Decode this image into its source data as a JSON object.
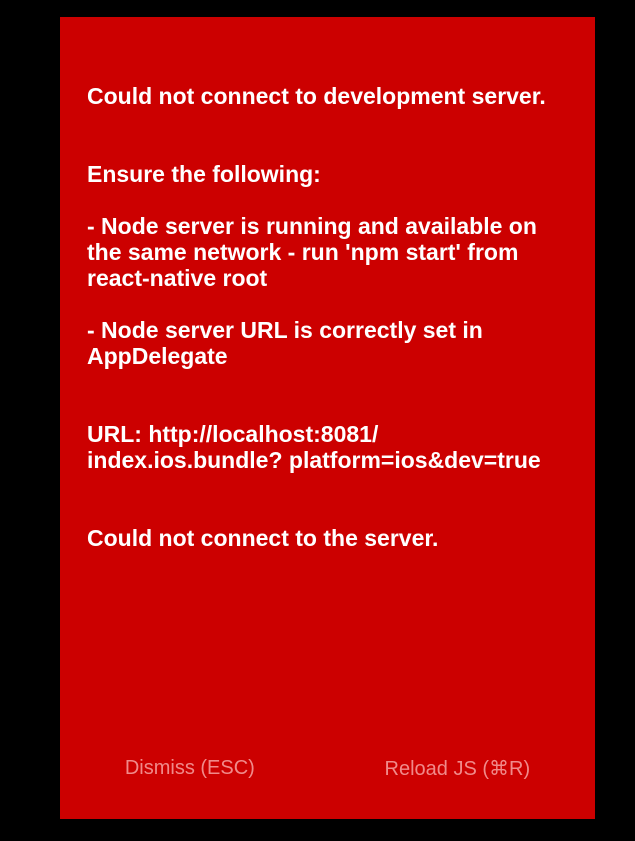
{
  "error_screen": {
    "title": "Could not connect to development server.",
    "instructions_heading": "Ensure the following:",
    "instruction_1": "- Node server is running and available on the same network - run 'npm start' from react-native root",
    "instruction_2": "- Node server URL is correctly set in AppDelegate",
    "url_line": "URL: http://localhost:8081/ index.ios.bundle? platform=ios&dev=true",
    "footer_message": "Could not connect to the server.",
    "background_color": "#cc0000",
    "text_color": "#ffffff"
  },
  "actions": {
    "dismiss_label": "Dismiss (ESC)",
    "reload_label": "Reload JS (⌘R)"
  }
}
